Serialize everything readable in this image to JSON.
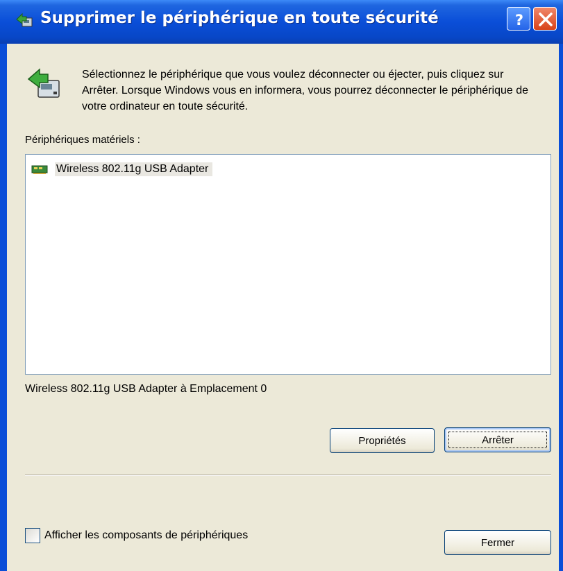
{
  "window": {
    "title": "Supprimer le périphérique en toute sécurité",
    "help_label": "?",
    "close_label": "×"
  },
  "intro": {
    "text": "Sélectionnez le périphérique que vous voulez déconnecter ou éjecter, puis cliquez sur Arrêter. Lorsque Windows vous en informera, vous pourrez déconnecter le périphérique de votre ordinateur en toute sécurité.",
    "icon": "safely-remove-hardware-icon"
  },
  "hardware_list": {
    "label": "Périphériques matériels :",
    "items": [
      {
        "label": "Wireless 802.11g USB Adapter",
        "icon": "network-adapter-icon"
      }
    ]
  },
  "location_text": "Wireless 802.11g USB Adapter à Emplacement 0",
  "buttons": {
    "properties": "Propriétés",
    "stop": "Arrêter",
    "close": "Fermer"
  },
  "show_components": {
    "label": "Afficher les composants de périphériques",
    "checked": false
  },
  "colors": {
    "titlebar": "#0a4ed8",
    "dialog_bg": "#ece9d8",
    "list_border": "#7f9db9"
  }
}
